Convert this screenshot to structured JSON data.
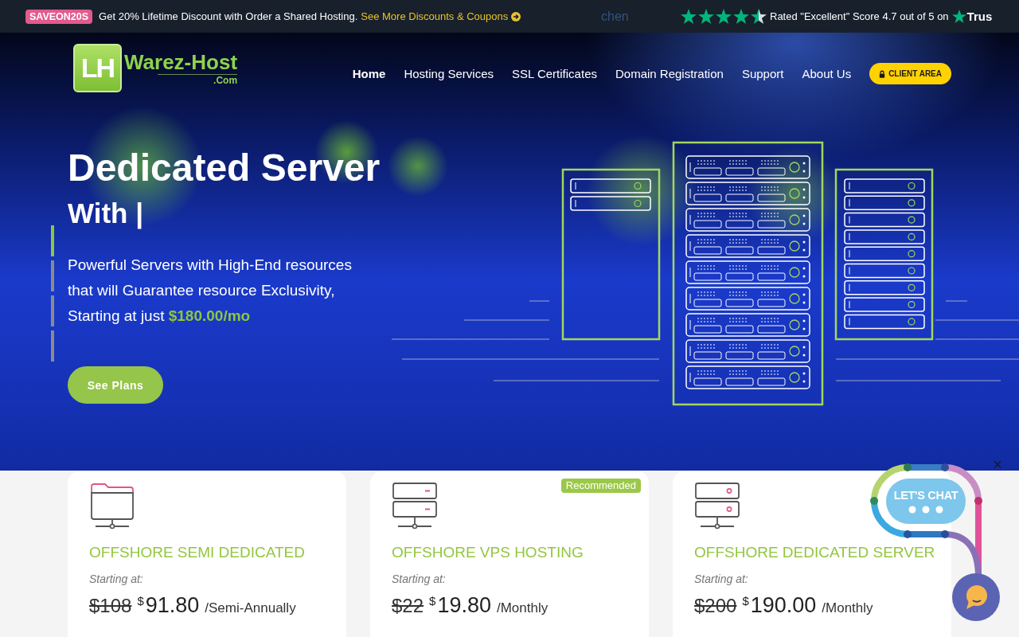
{
  "promo_bar": {
    "coupon_code": "SAVEON20S",
    "message": "Get 20% Lifetime Discount with Order a Shared Hosting.",
    "link": "See More Discounts & Coupons",
    "ticker_fragment": "chen",
    "rating": {
      "stars": 4.5,
      "text": "Rated \"Excellent\" Score 4.7 out of 5 on",
      "brand": "Trus"
    }
  },
  "header": {
    "logo": {
      "mark": "LH",
      "name": "Warez-Host",
      "suffix": ".Com"
    },
    "nav": [
      {
        "label": "Home",
        "selected": true
      },
      {
        "label": "Hosting Services",
        "selected": false
      },
      {
        "label": "SSL Certificates",
        "selected": false
      },
      {
        "label": "Domain Registration",
        "selected": false
      },
      {
        "label": "Support",
        "selected": false
      },
      {
        "label": "About Us",
        "selected": false
      }
    ],
    "client_area_button": "CLIENT AREA"
  },
  "hero": {
    "title": "Dedicated Server",
    "subtitle": "With |",
    "slide_indicators": [
      {
        "selected": true
      },
      {
        "selected": false
      },
      {
        "selected": false
      },
      {
        "selected": false
      }
    ],
    "description": "Powerful Servers with High-End resources\nthat will Guarantee resource Exclusivity,\nStarting at just **$180.00/mo**",
    "button": "See Plans"
  },
  "plans": [
    {
      "kind": "folder",
      "title": "OFFSHORE SEMI DEDICATED",
      "starting_label": "Starting at:",
      "old_price": "$108",
      "currency": "$",
      "price": "91.80",
      "period": "/Semi-Annually"
    },
    {
      "kind": "stack",
      "badge": "Recommended",
      "title": "OFFSHORE VPS HOSTING",
      "starting_label": "Starting at:",
      "old_price": "$22",
      "currency": "$",
      "price": "19.80",
      "period": "/Monthly"
    },
    {
      "kind": "server",
      "title": "OFFSHORE DEDICATED SERVER",
      "starting_label": "Starting at:",
      "old_price": "$200",
      "currency": "$",
      "price": "190.00",
      "period": "/Monthly"
    }
  ],
  "chat": {
    "label": "LET'S CHAT",
    "close": "×"
  }
}
